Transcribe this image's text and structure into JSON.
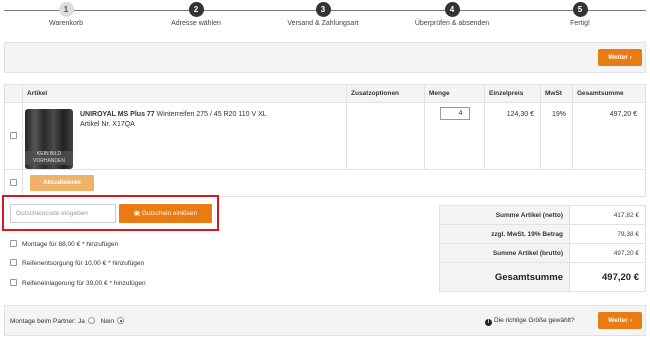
{
  "steps": [
    {
      "num": "1",
      "label": "Warenkorb"
    },
    {
      "num": "2",
      "label": "Adresse wählen"
    },
    {
      "num": "3",
      "label": "Versand & Zahlungsart"
    },
    {
      "num": "4",
      "label": "Überprüfen & absenden"
    },
    {
      "num": "5",
      "label": "Fertig!"
    }
  ],
  "weiter_label": "Weiter ›",
  "table": {
    "headers": {
      "artikel": "Artikel",
      "zusatz": "Zusatzoptionen",
      "menge": "Menge",
      "einzelpreis": "Einzelpreis",
      "mwst": "MwSt",
      "gesamt": "Gesamtsumme"
    },
    "item": {
      "brand": "UNIROYAL MS Plus 77",
      "desc": "Winterreifen 275 / 45 R20 110 V XL",
      "artnr": "Artikel Nr. X17QA",
      "image_text": "KEIN BILD VORHANDEN",
      "qty": "4",
      "unit_price": "124,30 €",
      "vat": "19%",
      "total": "497,20 €"
    },
    "update_label": "Aktualisieren"
  },
  "coupon": {
    "placeholder": "Gutscheincode eingeben",
    "button": "Gutschein einlösen"
  },
  "options": [
    "Montage für 88,00 € * hinzufügen",
    "Reifenentsorgung für 10,00 € * hinzufügen",
    "Reifeneinlagerung für 39,00 € * hinzufügen"
  ],
  "totals": [
    {
      "label": "Summe Artikel (netto)",
      "value": "417,82 €"
    },
    {
      "label": "zzgl. MwSt. 19% Betrag",
      "value": "79,38 €"
    },
    {
      "label": "Summe Artikel (brutto)",
      "value": "497,20 €"
    },
    {
      "label": "Gesamtsumme",
      "value": "497,20 €"
    }
  ],
  "montage": {
    "label": "Montage beim Partner:",
    "ja": "Ja",
    "nein": "Nein",
    "size_hint": "Die richtige Größe gewählt?"
  }
}
